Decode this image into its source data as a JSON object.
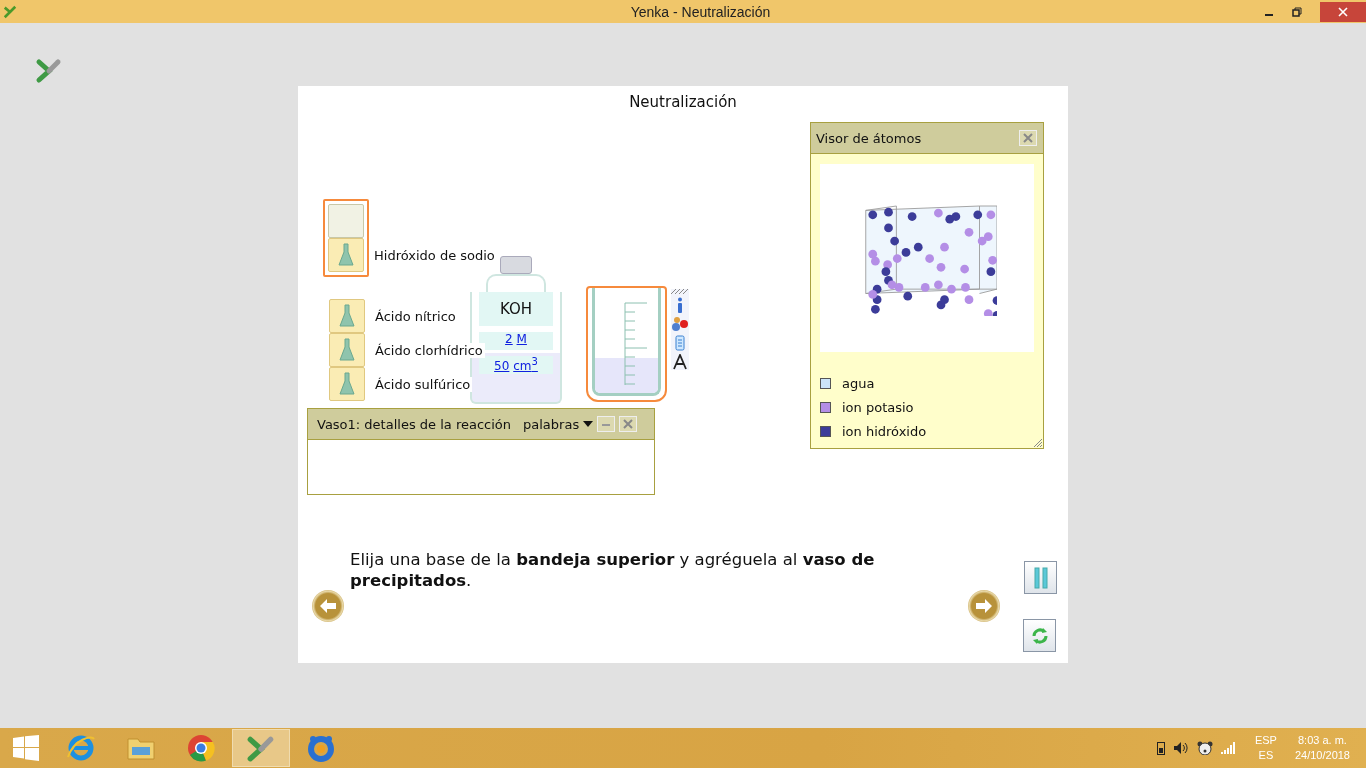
{
  "window": {
    "title": "Yenka - Neutralización"
  },
  "page": {
    "title": "Neutralización"
  },
  "trays": [
    {
      "selected": true,
      "items": [
        {
          "kind": "empty"
        },
        {
          "kind": "flask",
          "label": "Hidróxido de sodio"
        }
      ]
    },
    {
      "selected": false,
      "items": [
        {
          "kind": "flask",
          "label": "Ácido nítrico"
        },
        {
          "kind": "flask",
          "label": "Ácido clorhídrico"
        },
        {
          "kind": "flask",
          "label": "Ácido sulfúrico"
        }
      ]
    }
  ],
  "bottle": {
    "formula": "KOH",
    "concentration": "2",
    "concentration_unit": "M",
    "volume": "50",
    "volume_unit": "cm$^{3}$"
  },
  "beaker": {
    "selected": true,
    "level": 0.33
  },
  "reaction_panel": {
    "title": "Vaso1: detalles de la reacción",
    "mode": "palabras"
  },
  "atom_viewer": {
    "title": "Visor de átomos",
    "legend": [
      {
        "label": "agua",
        "color": "#cce4f8"
      },
      {
        "label": "ion potasio",
        "color": "#b48ee6"
      },
      {
        "label": "ion hidróxido",
        "color": "#3c3c99"
      }
    ]
  },
  "instruction": "Elija una base de la **bandeja superior** y agréguela al **vaso de precipitados**.",
  "taskbar": {
    "apps": [
      {
        "kind": "ie",
        "selected": false
      },
      {
        "kind": "folder",
        "selected": false
      },
      {
        "kind": "chrome",
        "selected": false
      },
      {
        "kind": "yenka",
        "selected": true
      },
      {
        "kind": "ring",
        "selected": false
      }
    ],
    "language": "ESP",
    "layout": "ES",
    "time": "8:03 a. m.",
    "date": "24/10/2018"
  }
}
